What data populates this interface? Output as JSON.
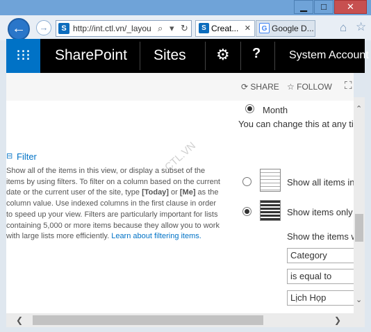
{
  "browser": {
    "window_buttons": {
      "minimize": "▁",
      "maximize": "□",
      "close": "✕"
    },
    "back_glyph": "←",
    "forward_glyph": "→",
    "address_icon": "S",
    "address": "http://int.ctl.vn/_layou",
    "address_search_glyph": "⌕",
    "address_dropdown_glyph": "▾",
    "address_refresh_glyph": "↻",
    "tabs": [
      {
        "icon": "S",
        "label": "Creat...",
        "close": "✕",
        "color": "#0b6cbd"
      },
      {
        "icon": "G",
        "label": "Google D...",
        "close": "",
        "color": "#4285f4"
      }
    ],
    "home_glyph": "⌂",
    "star_glyph": "☆"
  },
  "suitebar": {
    "waffle_glyph": "⁝⁝⁝",
    "brand": "SharePoint",
    "sites": "Sites",
    "gear_glyph": "⚙",
    "help_glyph": "?",
    "account": "System Account"
  },
  "actions": {
    "share": "SHARE",
    "share_glyph": "⟳",
    "follow": "FOLLOW",
    "follow_glyph": "☆",
    "focus_glyph": "⛶"
  },
  "grouping": {
    "month_label": "Month",
    "change_note": "You can change this at any ti"
  },
  "filter": {
    "toggle_glyph": "⊟",
    "heading": "Filter",
    "desc_1": "Show all of the items in this view, or display a subset of the items by using filters. To filter on a column based on the current date or the current user of the site, type ",
    "today": "[Today]",
    "desc_or": " or ",
    "me": "[Me]",
    "desc_2": " as the column value. Use indexed columns in the first clause in order to speed up your view. Filters are particularly important for lists containing 5,000 or more items because they allow you to work with large lists more efficiently. ",
    "link": "Learn about filtering items.",
    "show_all_label": "Show all items in",
    "show_only_label": "Show items only",
    "show_items_label": "Show the items w",
    "column_value": "Category",
    "operator_value": "is equal to",
    "filter_value": "Lịch Họp"
  },
  "watermark": "CTL.VN",
  "scroll": {
    "up": "⌃",
    "down": "⌄",
    "left": "❮",
    "right": "❯"
  }
}
